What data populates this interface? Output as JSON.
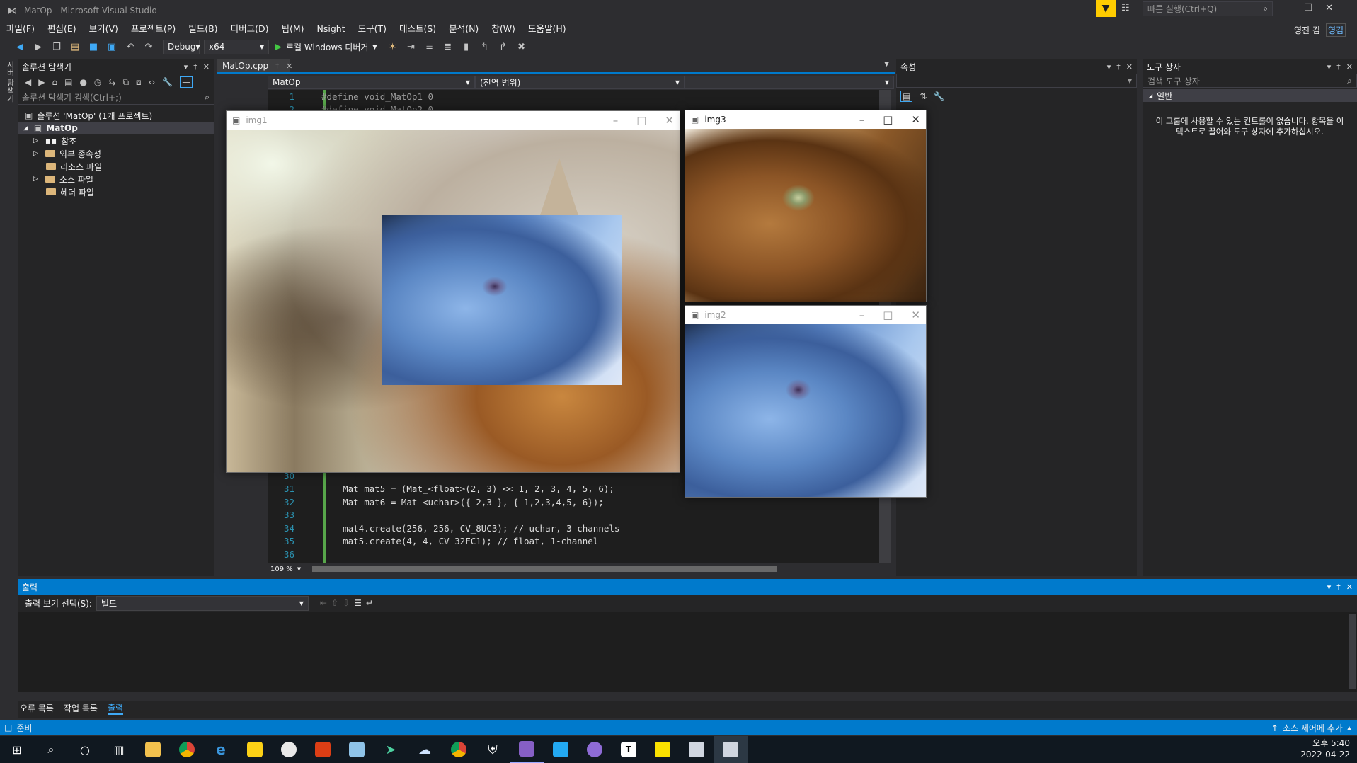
{
  "window": {
    "title": "MatOp - Microsoft Visual Studio",
    "quick_launch": "빠른 실행(Ctrl+Q)",
    "user": "영진 김",
    "user_badge": "영김"
  },
  "menu": [
    "파일(F)",
    "편집(E)",
    "보기(V)",
    "프로젝트(P)",
    "빌드(B)",
    "디버그(D)",
    "팀(M)",
    "Nsight",
    "도구(T)",
    "테스트(S)",
    "분석(N)",
    "창(W)",
    "도움말(H)"
  ],
  "toolbar": {
    "config": "Debug",
    "platform": "x64",
    "run_label": "로컬 Windows 디버거"
  },
  "left_sidebar_tab": "서버 탐색기",
  "solution_explorer": {
    "title": "솔루션 탐색기",
    "search_placeholder": "솔루션 탐색기 검색(Ctrl+;)",
    "root": "솔루션 'MatOp' (1개 프로젝트)",
    "project": "MatOp",
    "items": [
      "참조",
      "외부 종속성",
      "리소스 파일",
      "소스 파일",
      "헤더 파일"
    ]
  },
  "editor": {
    "tab": "MatOp.cpp",
    "nav_project": "MatOp",
    "nav_scope": "(전역 범위)",
    "zoom": "109 %",
    "top_lines": [
      {
        "n": "1",
        "text": "#define void_MatOp1 0"
      },
      {
        "n": "2",
        "text": "#define void_MatOp2 0"
      }
    ],
    "lines": [
      {
        "n": "30",
        "code": ""
      },
      {
        "n": "31",
        "code": "    Mat mat5 = (Mat_<float>(2, 3) << 1, 2, 3, 4, 5, 6);"
      },
      {
        "n": "32",
        "code": "    Mat mat6 = Mat_<uchar>({ 2,3 }, { 1,2,3,4,5, 6});"
      },
      {
        "n": "33",
        "code": ""
      },
      {
        "n": "34",
        "code": "    mat4.create(256, 256, CV_8UC3); // uchar, 3-channels"
      },
      {
        "n": "35",
        "code": "    mat5.create(4, 4, CV_32FC1); // float, 1-channel"
      },
      {
        "n": "36",
        "code": ""
      }
    ]
  },
  "properties": {
    "title": "속성"
  },
  "toolbox": {
    "title": "도구 상자",
    "search_placeholder": "검색 도구 상자",
    "group": "일반",
    "empty_message": "이 그룹에 사용할 수 있는 컨트롤이 없습니다. 항목을 이 텍스트로 끌어와 도구 상자에 추가하십시오."
  },
  "output": {
    "title": "출력",
    "show_label": "출력 보기 선택(S):",
    "source": "빌드",
    "bottom_tabs": [
      "오류 목록",
      "작업 목록",
      "출력"
    ]
  },
  "status": {
    "ready": "준비",
    "source_control": "소스 제어에 추가"
  },
  "image_windows": [
    {
      "id": "img1",
      "title": "img1"
    },
    {
      "id": "img3",
      "title": "img3"
    },
    {
      "id": "img2",
      "title": "img2"
    }
  ],
  "taskbar": {
    "time": "오후 5:40",
    "date": "2022-04-22"
  },
  "colors": {
    "accent": "#007acc",
    "bg": "#2d2d30",
    "editor_bg": "#1e1e1e",
    "filter_badge": "#ffcc00"
  }
}
